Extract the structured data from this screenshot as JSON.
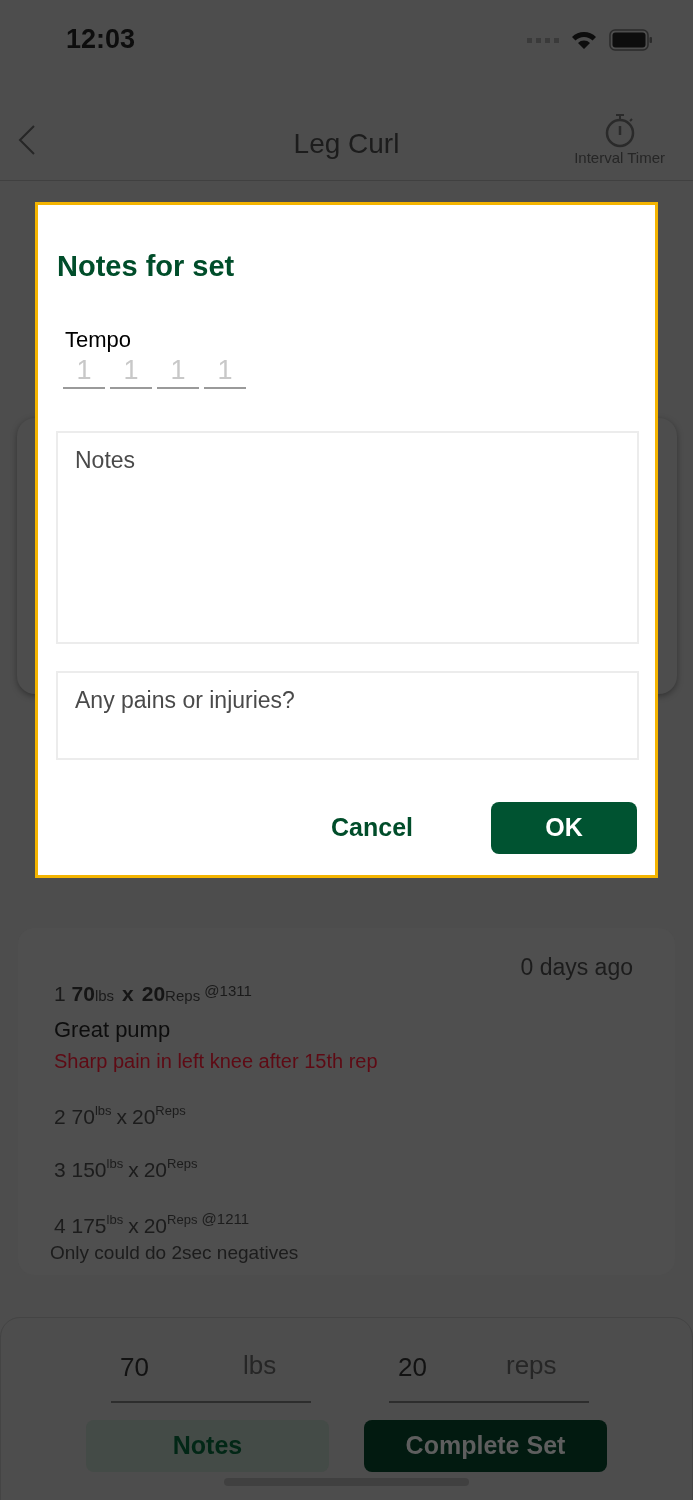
{
  "status_bar": {
    "time": "12:03"
  },
  "nav": {
    "title": "Leg Curl",
    "timer_label": "Interval Timer"
  },
  "dialog": {
    "title": "Notes for set",
    "tempo_label": "Tempo",
    "tempo_digits": [
      {
        "placeholder": "1"
      },
      {
        "placeholder": "1"
      },
      {
        "placeholder": "1"
      },
      {
        "placeholder": "1"
      }
    ],
    "notes_field": {
      "placeholder": "Notes"
    },
    "pain_field": {
      "placeholder": "Any pains or injuries?"
    },
    "buttons": [
      {
        "label": "Cancel",
        "kind": "text"
      },
      {
        "label": "OK",
        "kind": "filled"
      }
    ]
  },
  "history": {
    "age": "0 days ago",
    "sets": [
      {
        "number": "1",
        "weight": "70",
        "weight_unit": "lbs",
        "times": "x",
        "reps": "20",
        "reps_unit": "Reps",
        "tempo": "@1311",
        "notes": "Great pump",
        "pain": "Sharp pain in left knee after 15th rep",
        "current": true
      },
      {
        "number": "2",
        "weight": "70",
        "weight_unit": "lbs",
        "times": "x",
        "reps": "20",
        "reps_unit": "Reps",
        "current": false
      },
      {
        "number": "3",
        "weight": "150",
        "weight_unit": "lbs",
        "times": "x",
        "reps": "20",
        "reps_unit": "Reps",
        "current": false
      },
      {
        "number": "4",
        "weight": "175",
        "weight_unit": "lbs",
        "times": "x",
        "reps": "20",
        "reps_unit": "Reps",
        "tempo": "@1211",
        "notes": "Only could do 2sec negatives",
        "current": false
      }
    ]
  },
  "entry": {
    "weight_value": "70",
    "weight_unit": "lbs",
    "reps_value": "20",
    "reps_unit": "reps",
    "buttons": [
      {
        "label": "Notes",
        "kind": "secondary"
      },
      {
        "label": "Complete Set",
        "kind": "primary"
      }
    ]
  }
}
